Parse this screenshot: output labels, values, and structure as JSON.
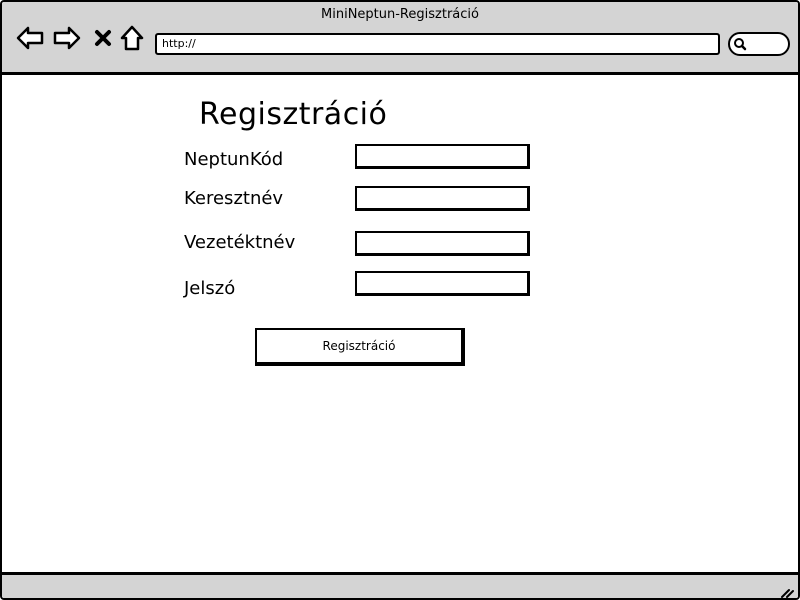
{
  "window": {
    "title": "MiniNeptun-Regisztráció"
  },
  "toolbar": {
    "back_icon": "back-arrow-icon",
    "forward_icon": "forward-arrow-icon",
    "stop_icon": "close-icon",
    "home_icon": "home-icon",
    "url": "http://",
    "search_icon": "search-icon"
  },
  "form": {
    "title": "Regisztráció",
    "fields": [
      {
        "label": "NeptunKód",
        "value": ""
      },
      {
        "label": "Keresztnév",
        "value": ""
      },
      {
        "label": "Vezetéktnév",
        "value": ""
      },
      {
        "label": "Jelszó",
        "value": ""
      }
    ],
    "submit_label": "Regisztráció"
  },
  "statusbar": {
    "grip_icon": "resize-grip-icon"
  },
  "colors": {
    "chrome": "#d4d4d4",
    "border": "#000000",
    "background": "#ffffff"
  }
}
